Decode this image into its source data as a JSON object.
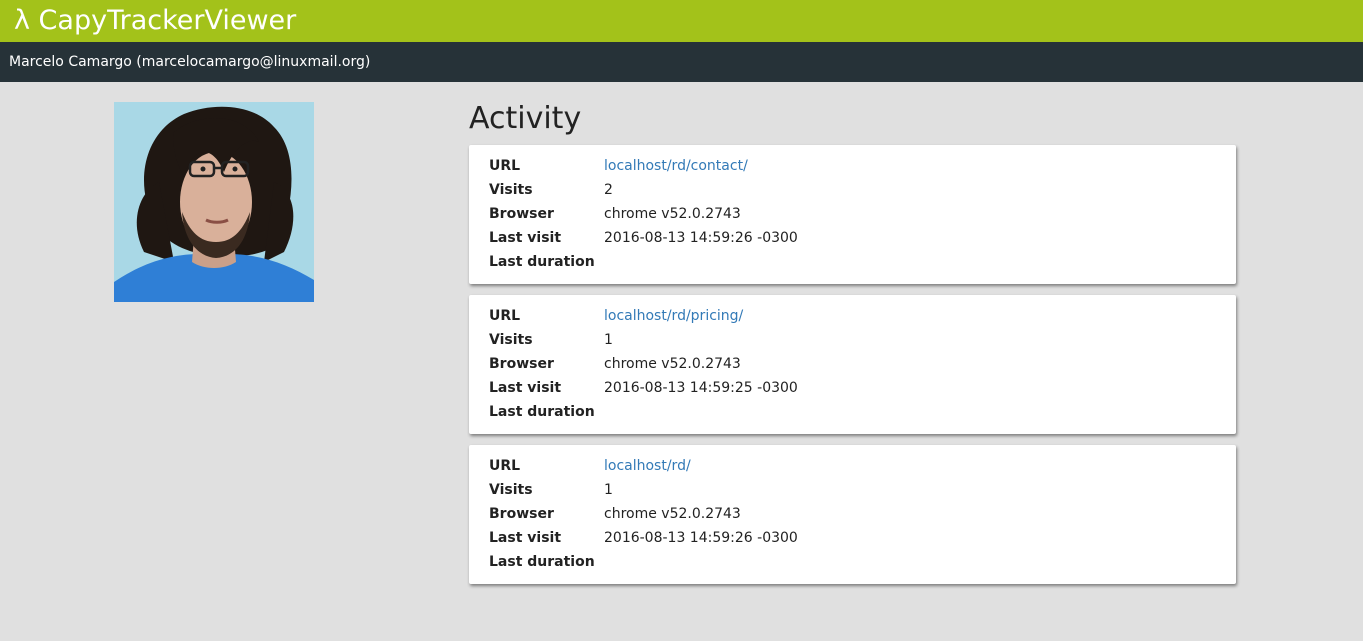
{
  "app": {
    "title": "λ CapyTrackerViewer"
  },
  "user": {
    "info": "Marcelo Camargo (marcelocamargo@linuxmail.org)"
  },
  "activity": {
    "heading": "Activity",
    "labels": {
      "url": "URL",
      "visits": "Visits",
      "browser": "Browser",
      "last_visit": "Last visit",
      "last_duration": "Last duration"
    },
    "entries": [
      {
        "url": "localhost/rd/contact/",
        "visits": "2",
        "browser": "chrome v52.0.2743",
        "last_visit": "2016-08-13 14:59:26 -0300",
        "last_duration": ""
      },
      {
        "url": "localhost/rd/pricing/",
        "visits": "1",
        "browser": "chrome v52.0.2743",
        "last_visit": "2016-08-13 14:59:25 -0300",
        "last_duration": ""
      },
      {
        "url": "localhost/rd/",
        "visits": "1",
        "browser": "chrome v52.0.2743",
        "last_visit": "2016-08-13 14:59:26 -0300",
        "last_duration": ""
      }
    ]
  },
  "colors": {
    "header_accent": "#a3c21a",
    "user_bar": "#263238",
    "page_background": "#e0e0e0",
    "link": "#337ab7"
  }
}
